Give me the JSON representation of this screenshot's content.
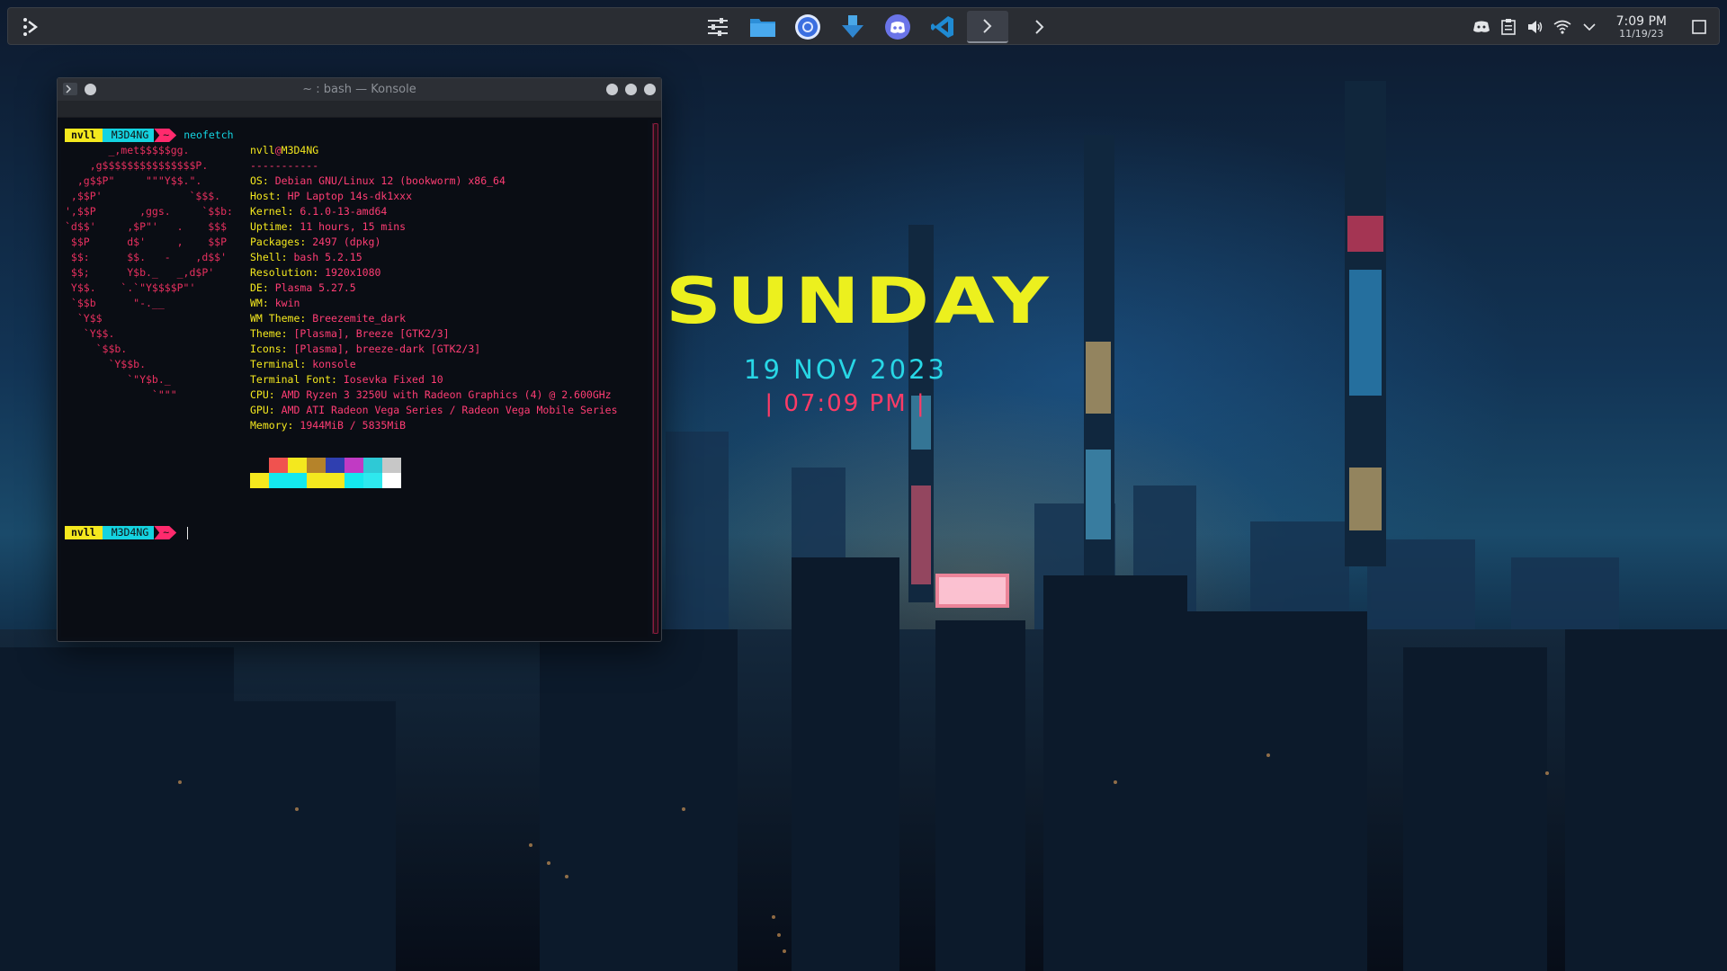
{
  "panel": {
    "tasks": [
      {
        "name": "system-settings-task",
        "icon": "sliders-icon"
      },
      {
        "name": "dolphin-task",
        "icon": "folder-icon"
      },
      {
        "name": "chromium-task",
        "icon": "browser-icon"
      },
      {
        "name": "download-manager-task",
        "icon": "download-icon"
      },
      {
        "name": "discord-task",
        "icon": "discord-icon"
      },
      {
        "name": "vscode-task",
        "icon": "vscode-icon"
      },
      {
        "name": "konsole-task-1",
        "icon": "terminal-icon"
      },
      {
        "name": "konsole-task-2",
        "icon": "terminal-icon"
      }
    ],
    "clock_time": "7:09 PM",
    "clock_date": "11/19/23"
  },
  "konsole": {
    "title": "~ : bash — Konsole",
    "prompt": {
      "user": "nvll",
      "host": "M3D4NG",
      "dir": "~"
    },
    "command": "neofetch",
    "logo": "       _,met$$$$$gg.\n    ,g$$$$$$$$$$$$$$$P.\n  ,g$$P\"     \"\"\"Y$$.\".\n ,$$P'              `$$$.\n',$$P       ,ggs.     `$$b:\n`d$$'     ,$P\"'   .    $$$\n $$P      d$'     ,    $$P\n $$:      $$.   -    ,d$$'\n $$;      Y$b._   _,d$P'\n Y$$.    `.`\"Y$$$$P\"'\n `$$b      \"-.__\n  `Y$$\n   `Y$$.\n     `$$b.\n       `Y$$b.\n          `\"Y$b._\n              `\"\"\"",
    "user_host": {
      "user": "nvll",
      "at": "@",
      "host": "M3D4NG"
    },
    "separator": "-----------",
    "info": [
      {
        "k": "OS",
        "v": "Debian GNU/Linux 12 (bookworm) x86_64"
      },
      {
        "k": "Host",
        "v": "HP Laptop 14s-dk1xxx"
      },
      {
        "k": "Kernel",
        "v": "6.1.0-13-amd64"
      },
      {
        "k": "Uptime",
        "v": "11 hours, 15 mins"
      },
      {
        "k": "Packages",
        "v": "2497 (dpkg)"
      },
      {
        "k": "Shell",
        "v": "bash 5.2.15"
      },
      {
        "k": "Resolution",
        "v": "1920x1080"
      },
      {
        "k": "DE",
        "v": "Plasma 5.27.5"
      },
      {
        "k": "WM",
        "v": "kwin"
      },
      {
        "k": "WM Theme",
        "v": "Breezemite_dark"
      },
      {
        "k": "Theme",
        "v": "[Plasma], Breeze [GTK2/3]"
      },
      {
        "k": "Icons",
        "v": "[Plasma], breeze-dark [GTK2/3]"
      },
      {
        "k": "Terminal",
        "v": "konsole"
      },
      {
        "k": "Terminal Font",
        "v": "Iosevka Fixed 10"
      },
      {
        "k": "CPU",
        "v": "AMD Ryzen 3 3250U with Radeon Graphics (4) @ 2.600GHz"
      },
      {
        "k": "GPU",
        "v": "AMD ATI Radeon Vega Series / Radeon Vega Mobile Series"
      },
      {
        "k": "Memory",
        "v": "1944MiB / 5835MiB"
      }
    ],
    "palette_top": [
      "#0a0d14",
      "#f0524f",
      "#f4e81e",
      "#b5832a",
      "#2f3fb0",
      "#c13ac4",
      "#2ec9d6",
      "#c7c7c7"
    ],
    "palette_bottom": [
      "#f4e81e",
      "#14e8ee",
      "#14e8ee",
      "#f4e81e",
      "#f4e81e",
      "#14e8ee",
      "#2ee8ee",
      "#ffffff"
    ]
  },
  "widget": {
    "day": "SUNDAY",
    "date": "19 NOV 2023",
    "time": "| 07:09 PM |"
  },
  "colors": {
    "yellow": "#f4e81e",
    "cyan": "#14d3e0",
    "pink": "#ff2a6d",
    "panel": "#2a2d33"
  }
}
